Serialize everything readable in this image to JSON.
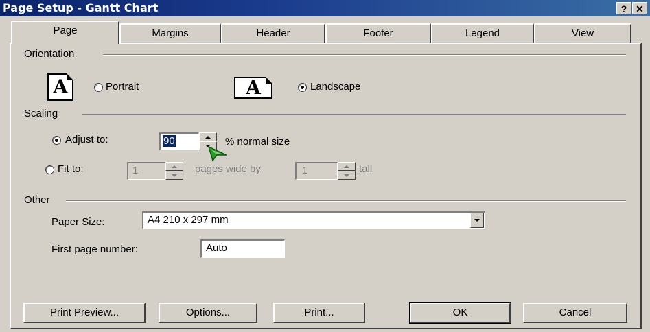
{
  "window": {
    "title": "Page Setup - Gantt Chart",
    "help_label": "?",
    "close_label": "✕"
  },
  "tabs": [
    "Page",
    "Margins",
    "Header",
    "Footer",
    "Legend",
    "View"
  ],
  "orientation": {
    "label": "Orientation",
    "icon_letter": "A",
    "portrait_label": "Portrait",
    "landscape_label": "Landscape",
    "selected": "landscape"
  },
  "scaling": {
    "label": "Scaling",
    "adjust_label": "Adjust to:",
    "adjust_value": "90",
    "normal_size_label": "% normal size",
    "fit_label": "Fit to:",
    "fit_wide_value": "1",
    "pages_wide_label": "pages wide by",
    "fit_tall_value": "1",
    "tall_label": "tall",
    "selected": "adjust"
  },
  "other": {
    "label": "Other",
    "paper_size_label": "Paper Size:",
    "paper_size_value": "A4 210 x 297 mm",
    "first_page_label": "First page number:",
    "first_page_value": "Auto"
  },
  "buttons": {
    "print_preview": "Print Preview...",
    "options": "Options...",
    "print": "Print...",
    "ok": "OK",
    "cancel": "Cancel"
  },
  "colors": {
    "titlebar": "#0a246a",
    "face": "#d4d0c8",
    "cursor": "#2e9a2e"
  }
}
